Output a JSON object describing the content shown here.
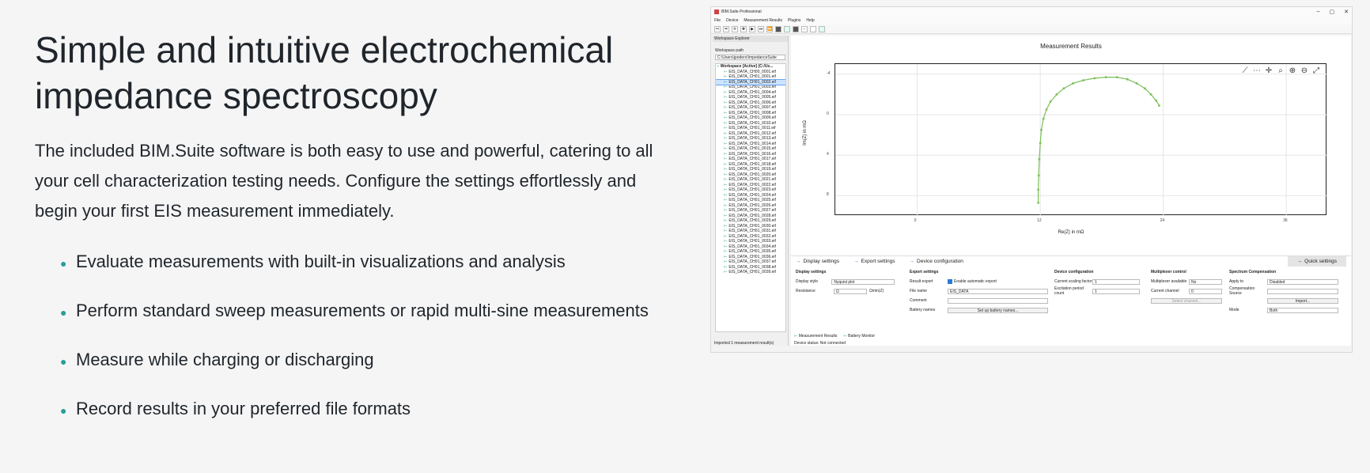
{
  "copy": {
    "headline_line1": "Simple and intuitive electrochemical",
    "headline_line2": "impedance spectroscopy",
    "lead": "The included BIM.Suite software is both easy to use and powerful, catering to all your cell characterization testing needs. Configure the settings effortlessly and begin your first EIS measurement immediately.",
    "bullets": [
      "Evaluate measurements with built-in visualizations and analysis",
      "Perform standard sweep measurements or rapid multi-sine measurements",
      "Measure while charging or discharging",
      "Record results in your preferred file formats"
    ],
    "accent_color": "#2a9d9a"
  },
  "app": {
    "title": "BIM.Suite Professional",
    "window_controls": [
      "–",
      "▢",
      "✕"
    ],
    "menu": [
      "File",
      "Device",
      "Measurement Results",
      "Plugins",
      "Help"
    ],
    "explorer": {
      "header": "Workspace Explorer",
      "path_label": "Workspace path",
      "path_value": "C:\\Users\\jpoders\\ImpedanceSuite",
      "root": "Workspace [Active] (C:/Us...",
      "files": [
        "EIS_DATA_CH00_0001.eif",
        "EIS_DATA_CH01_0001.eif",
        "EIS_DATA_CH01_0002.eif",
        "EIS_DATA_CH01_0003.eif",
        "EIS_DATA_CH01_0004.eif",
        "EIS_DATA_CH01_0005.eif",
        "EIS_DATA_CH01_0006.eif",
        "EIS_DATA_CH01_0007.eif",
        "EIS_DATA_CH01_0008.eif",
        "EIS_DATA_CH01_0009.eif",
        "EIS_DATA_CH01_0010.eif",
        "EIS_DATA_CH01_0011.eif",
        "EIS_DATA_CH01_0012.eif",
        "EIS_DATA_CH01_0013.eif",
        "EIS_DATA_CH01_0014.eif",
        "EIS_DATA_CH01_0015.eif",
        "EIS_DATA_CH01_0016.eif",
        "EIS_DATA_CH01_0017.eif",
        "EIS_DATA_CH01_0018.eif",
        "EIS_DATA_CH01_0019.eif",
        "EIS_DATA_CH01_0020.eif",
        "EIS_DATA_CH01_0021.eif",
        "EIS_DATA_CH01_0022.eif",
        "EIS_DATA_CH01_0023.eif",
        "EIS_DATA_CH01_0024.eif",
        "EIS_DATA_CH01_0025.eif",
        "EIS_DATA_CH01_0026.eif",
        "EIS_DATA_CH01_0027.eif",
        "EIS_DATA_CH01_0028.eif",
        "EIS_DATA_CH01_0029.eif",
        "EIS_DATA_CH01_0030.eif",
        "EIS_DATA_CH01_0031.eif",
        "EIS_DATA_CH01_0032.eif",
        "EIS_DATA_CH01_0033.eif",
        "EIS_DATA_CH01_0034.eif",
        "EIS_DATA_CH01_0035.eif",
        "EIS_DATA_CH01_0036.eif",
        "EIS_DATA_CH01_0037.eif",
        "EIS_DATA_CH01_0038.eif",
        "EIS_DATA_CH01_0039.eif"
      ],
      "selected_index": 2,
      "status": "Imported 1 measurement result(s)"
    },
    "chart": {
      "title": "Measurement Results",
      "xlabel": "Re(Z) in mΩ",
      "ylabel": "Im(Z) in mΩ",
      "xticks": [
        "0",
        "12",
        "24",
        "36"
      ],
      "yticks": [
        "-4",
        "0",
        "4",
        "8"
      ],
      "tools": [
        "⟋",
        "⋯",
        "✛",
        "⌕",
        "⊕",
        "⊖",
        "⤢"
      ]
    },
    "tabs": [
      "Display settings",
      "Export settings",
      "Device configuration"
    ],
    "quick_settings": "Quick settings",
    "settings": {
      "display": {
        "title": "Display settings",
        "style_label": "Display style",
        "style_value": "Nyquist plot",
        "res_label": "Resistance",
        "res_value": "Ω",
        "res_unit": "Ωmin(Z)"
      },
      "export": {
        "title": "Export settings",
        "auto_label": "Result export",
        "auto_value": "Enable automatic export",
        "file_label": "File name",
        "file_value": "EIS_DATA",
        "comment_label": "Comment",
        "battery_label": "Battery names",
        "battery_btn": "Set up battery names..."
      },
      "device": {
        "title": "Device configuration",
        "scale_label": "Current scaling factor",
        "scale_value": "1",
        "period_label": "Excitation period count",
        "period_value": "1"
      },
      "mux": {
        "title": "Multiplexer control",
        "avail_label": "Multiplexer available",
        "avail_value": "No",
        "chan_label": "Current channel",
        "chan_value": "0",
        "select_btn": "Select channel..."
      },
      "comp": {
        "title": "Spectrum Compensation",
        "apply_label": "Apply to",
        "apply_value": "Disabled",
        "source_label": "Compensation Source",
        "import_btn": "Import...",
        "mode_label": "Mode",
        "mode_value": "Both"
      }
    },
    "bottom_tabs": [
      "Measurement Results",
      "Battery Monitor"
    ],
    "device_status": "Device status:  Not connected"
  },
  "chart_data": {
    "type": "scatter",
    "title": "Measurement Results",
    "xlabel": "Re(Z) in mΩ",
    "ylabel": "Im(Z) in mΩ",
    "xlim": [
      -8,
      40
    ],
    "ylim": [
      -5,
      10
    ],
    "y_inverted": true,
    "series": [
      {
        "color": "#7bbf5a",
        "x": [
          11.8,
          11.8,
          11.85,
          11.9,
          12.0,
          12.1,
          12.3,
          12.6,
          13.0,
          13.6,
          14.3,
          15.2,
          16.2,
          17.3,
          18.4,
          19.5,
          20.5,
          21.4,
          22.2,
          22.8,
          23.3,
          23.6
        ],
        "y": [
          8.7,
          7.4,
          6.0,
          4.4,
          2.8,
          1.5,
          0.4,
          -0.5,
          -1.3,
          -2.0,
          -2.6,
          -3.1,
          -3.4,
          -3.6,
          -3.7,
          -3.7,
          -3.5,
          -3.1,
          -2.6,
          -2.0,
          -1.4,
          -0.9
        ]
      }
    ]
  }
}
